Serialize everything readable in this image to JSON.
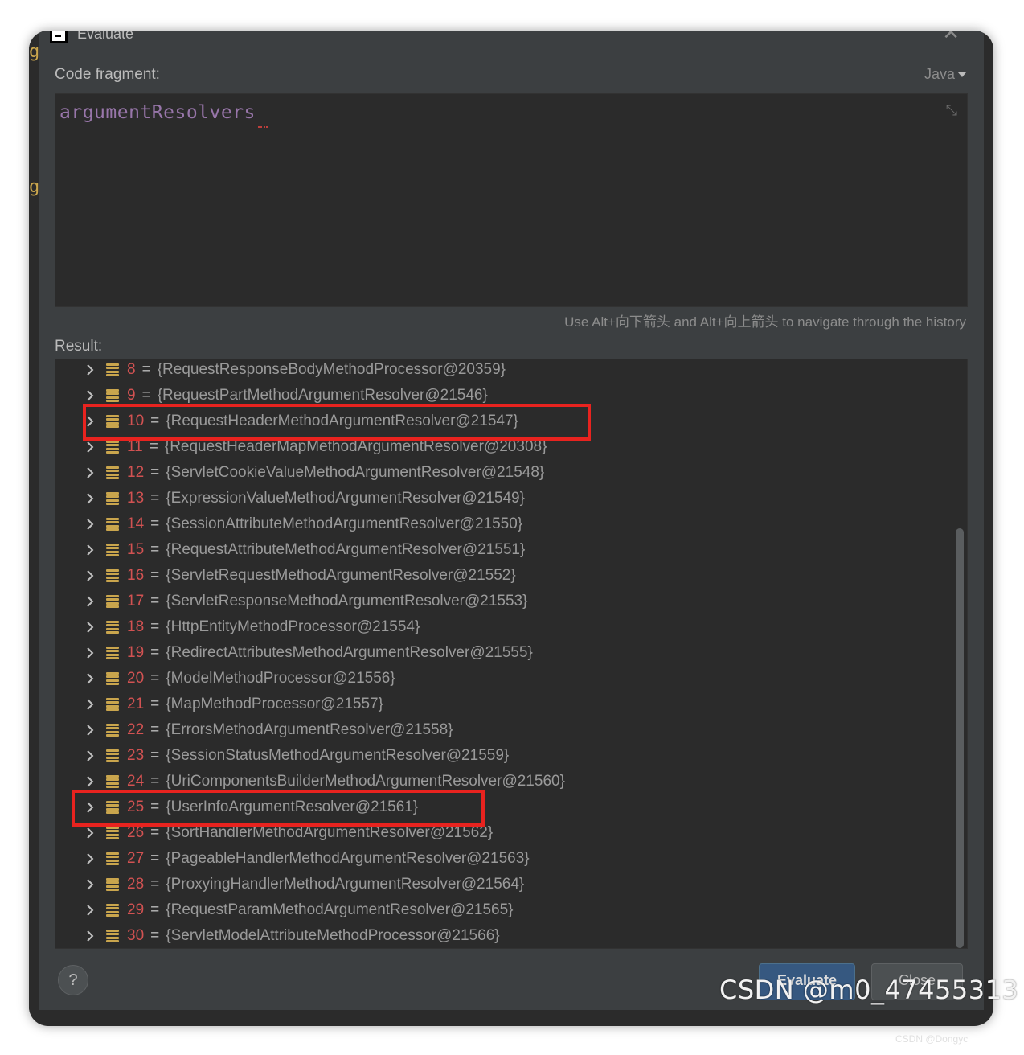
{
  "dialog": {
    "title": "Evaluate",
    "close_glyph": "✕"
  },
  "code_fragment": {
    "label": "Code fragment:",
    "language": "Java",
    "code": "argumentResolvers"
  },
  "history_hint": "Use Alt+向下箭头 and Alt+向上箭头 to navigate through the history",
  "result": {
    "label": "Result:",
    "rows": [
      {
        "index": "8",
        "value": "{RequestResponseBodyMethodProcessor@20359}"
      },
      {
        "index": "9",
        "value": "{RequestPartMethodArgumentResolver@21546}"
      },
      {
        "index": "10",
        "value": "{RequestHeaderMethodArgumentResolver@21547}"
      },
      {
        "index": "11",
        "value": "{RequestHeaderMapMethodArgumentResolver@20308}"
      },
      {
        "index": "12",
        "value": "{ServletCookieValueMethodArgumentResolver@21548}"
      },
      {
        "index": "13",
        "value": "{ExpressionValueMethodArgumentResolver@21549}"
      },
      {
        "index": "14",
        "value": "{SessionAttributeMethodArgumentResolver@21550}"
      },
      {
        "index": "15",
        "value": "{RequestAttributeMethodArgumentResolver@21551}"
      },
      {
        "index": "16",
        "value": "{ServletRequestMethodArgumentResolver@21552}"
      },
      {
        "index": "17",
        "value": "{ServletResponseMethodArgumentResolver@21553}"
      },
      {
        "index": "18",
        "value": "{HttpEntityMethodProcessor@21554}"
      },
      {
        "index": "19",
        "value": "{RedirectAttributesMethodArgumentResolver@21555}"
      },
      {
        "index": "20",
        "value": "{ModelMethodProcessor@21556}"
      },
      {
        "index": "21",
        "value": "{MapMethodProcessor@21557}"
      },
      {
        "index": "22",
        "value": "{ErrorsMethodArgumentResolver@21558}"
      },
      {
        "index": "23",
        "value": "{SessionStatusMethodArgumentResolver@21559}"
      },
      {
        "index": "24",
        "value": "{UriComponentsBuilderMethodArgumentResolver@21560}"
      },
      {
        "index": "25",
        "value": "{UserInfoArgumentResolver@21561}"
      },
      {
        "index": "26",
        "value": "{SortHandlerMethodArgumentResolver@21562}"
      },
      {
        "index": "27",
        "value": "{PageableHandlerMethodArgumentResolver@21563}"
      },
      {
        "index": "28",
        "value": "{ProxyingHandlerMethodArgumentResolver@21564}"
      },
      {
        "index": "29",
        "value": "{RequestParamMethodArgumentResolver@21565}"
      },
      {
        "index": "30",
        "value": "{ServletModelAttributeMethodProcessor@21566}"
      }
    ],
    "highlighted_indices": [
      "10",
      "25"
    ]
  },
  "buttons": {
    "help": "?",
    "evaluate": "Evaluate",
    "close": "Close"
  },
  "watermark": {
    "main": "CSDN @m0_47455313",
    "small": "CSDN @Dongyc"
  },
  "colors": {
    "dialog_bg": "#3c3f41",
    "editor_bg": "#2b2b2b",
    "code_purple": "#9876aa",
    "index_red": "#d25252",
    "field_icon": "#c9a54d",
    "highlight_red": "#e8231f",
    "evaluate_blue": "#365880"
  },
  "icons": {
    "expand": "chevron-right-icon",
    "field": "field-icon",
    "collapse": "collapse-icon",
    "app": "intellij-icon"
  }
}
